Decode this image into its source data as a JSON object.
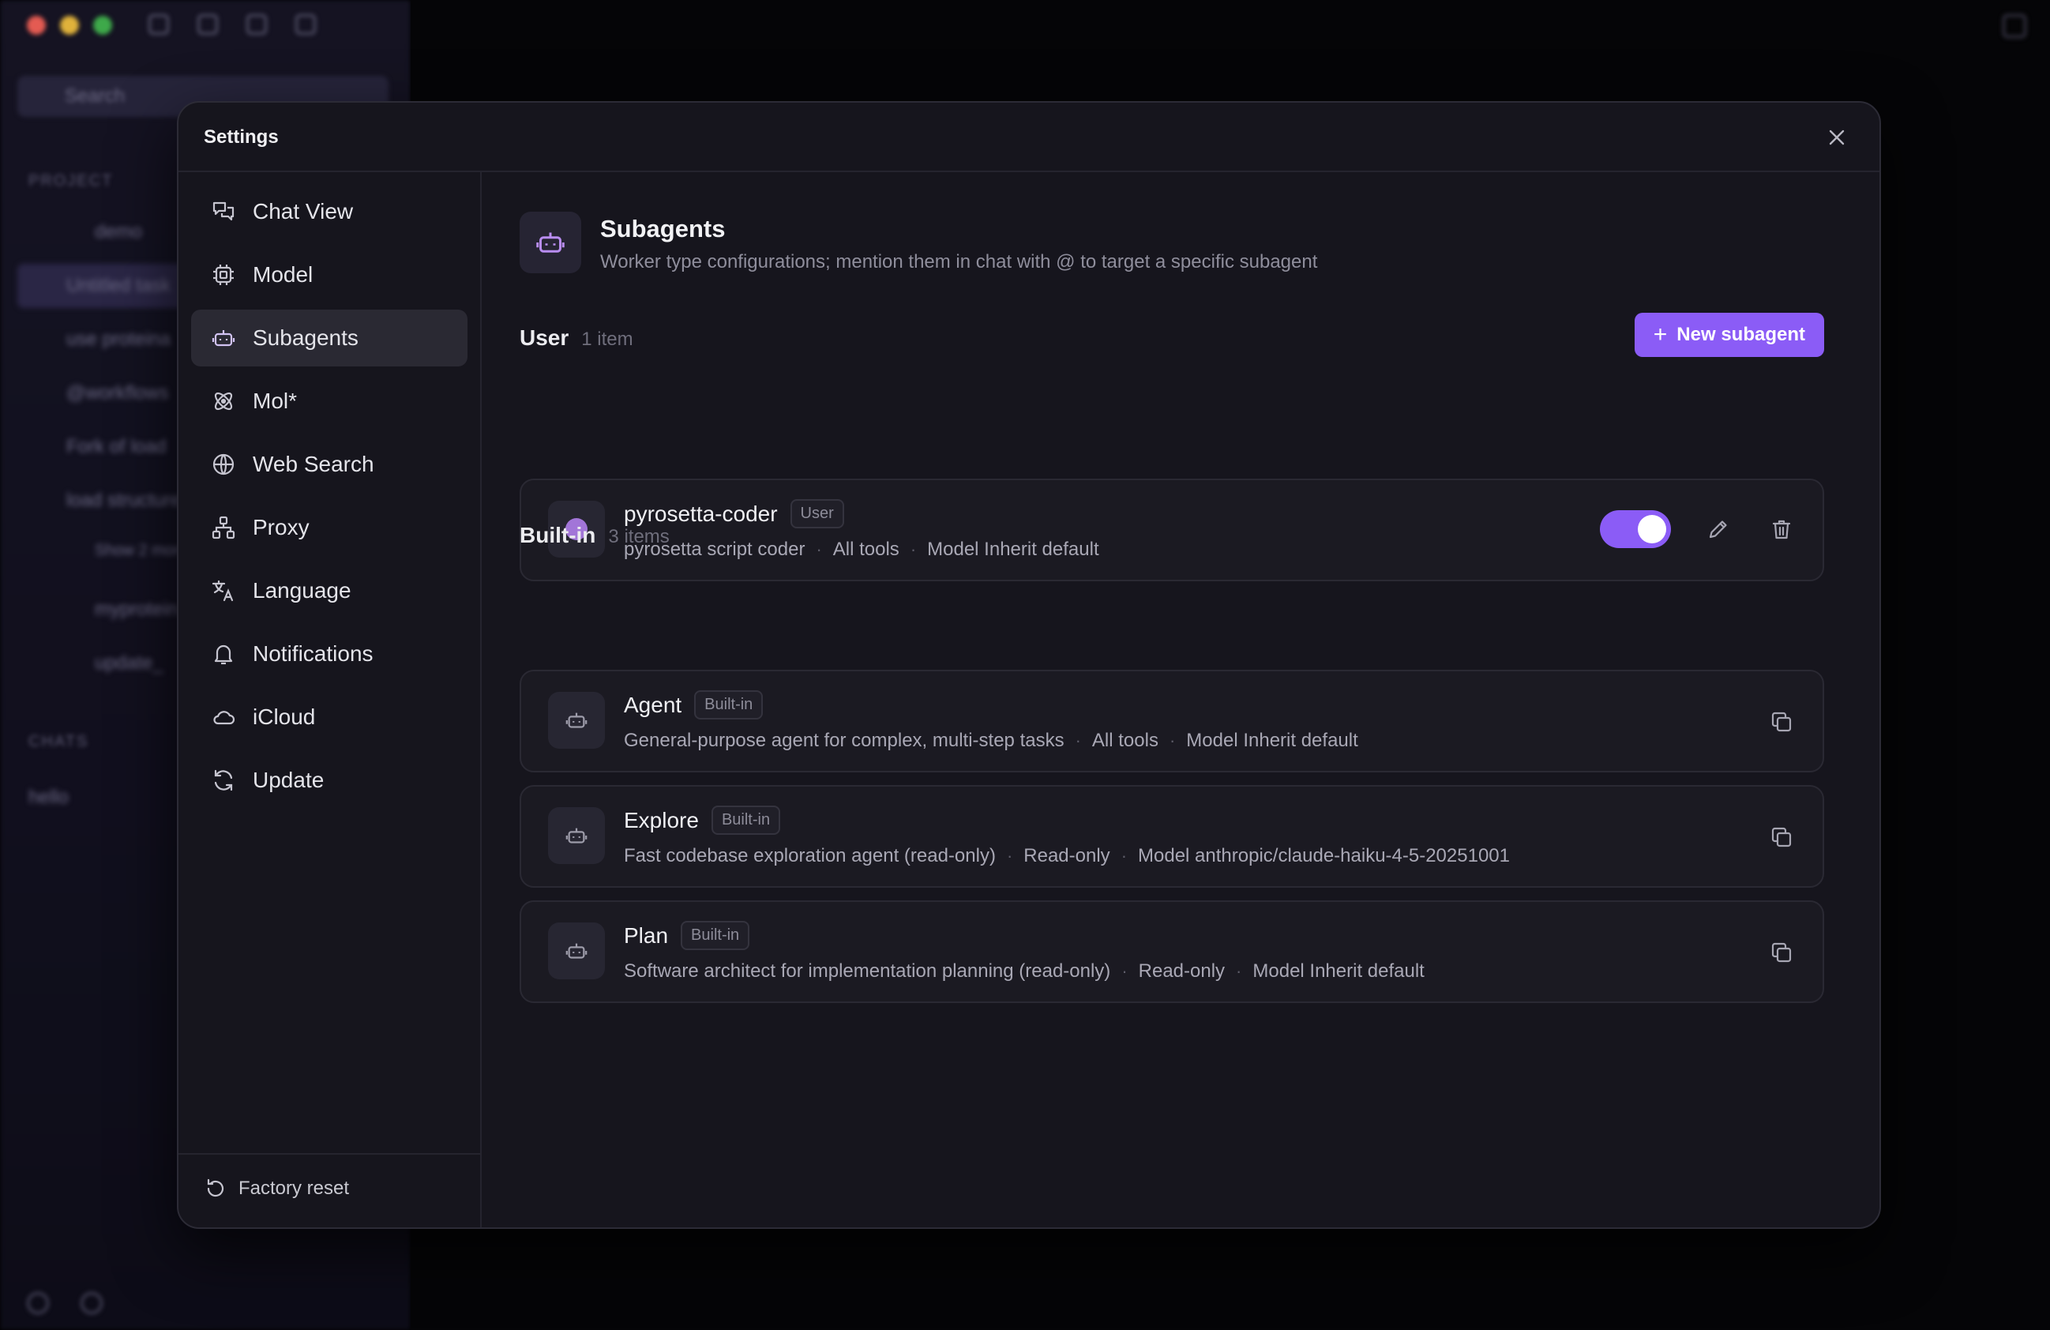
{
  "background_app": {
    "search_placeholder": "Search",
    "section_project": "PROJECT",
    "section_chats": "CHATS",
    "items": [
      "demo",
      "Untitled task",
      "use proteina",
      "@workflows",
      "Fork of load",
      "load structure",
      "Show 2 more",
      "myprotein",
      "update_"
    ],
    "chat_items": [
      "hello"
    ]
  },
  "dialog": {
    "title": "Settings",
    "close_label": "×"
  },
  "nav": {
    "items": [
      {
        "label": "Chat View",
        "icon": "chat-bubbles-icon"
      },
      {
        "label": "Model",
        "icon": "cpu-chip-icon"
      },
      {
        "label": "Subagents",
        "icon": "robot-icon"
      },
      {
        "label": "Mol*",
        "icon": "atom-icon"
      },
      {
        "label": "Web Search",
        "icon": "globe-icon"
      },
      {
        "label": "Proxy",
        "icon": "network-icon"
      },
      {
        "label": "Language",
        "icon": "translate-icon"
      },
      {
        "label": "Notifications",
        "icon": "bell-icon"
      },
      {
        "label": "iCloud",
        "icon": "cloud-icon"
      },
      {
        "label": "Update",
        "icon": "refresh-icon"
      }
    ],
    "active": "Subagents",
    "footer_label": "Factory reset"
  },
  "page": {
    "title": "Subagents",
    "description": "Worker type configurations; mention them in chat with @ to target a specific subagent",
    "new_button_label": "New subagent"
  },
  "sections": {
    "user": {
      "name": "User",
      "count": "1 item",
      "agents": [
        {
          "name": "pyrosetta-coder",
          "badge": "User",
          "description": "pyrosetta script coder",
          "tools": "All tools",
          "model": "Model Inherit default",
          "enabled": true
        }
      ]
    },
    "builtin": {
      "name": "Built-in",
      "count": "3 items",
      "agents": [
        {
          "name": "Agent",
          "badge": "Built-in",
          "description": "General-purpose agent for complex, multi-step tasks",
          "tools": "All tools",
          "model": "Model Inherit default"
        },
        {
          "name": "Explore",
          "badge": "Built-in",
          "description": "Fast codebase exploration agent (read-only)",
          "tools": "Read-only",
          "model": "Model anthropic/claude-haiku-4-5-20251001"
        },
        {
          "name": "Plan",
          "badge": "Built-in",
          "description": "Software architect for implementation planning (read-only)",
          "tools": "Read-only",
          "model": "Model Inherit default"
        }
      ]
    }
  },
  "colors": {
    "accent": "#8b5cf6",
    "user_dot": "#a275d8",
    "dialog_bg": "#16151d"
  }
}
